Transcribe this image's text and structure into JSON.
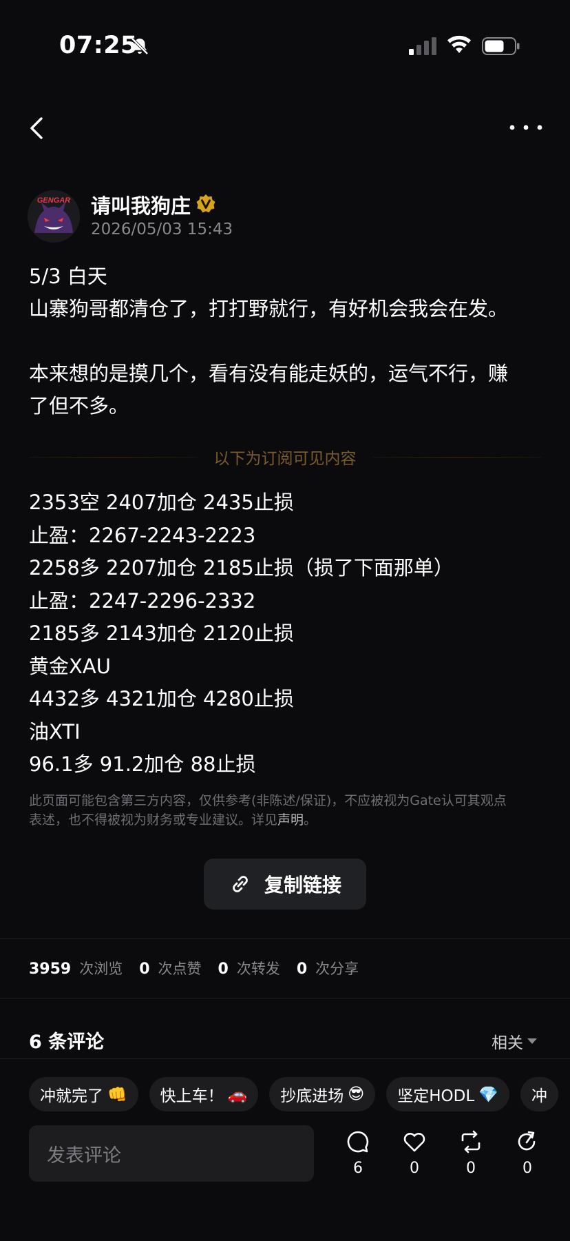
{
  "status": {
    "time": "07:25"
  },
  "author": {
    "name": "请叫我狗庄",
    "time": "2026/05/03 15:43",
    "avatar_text": "GENGAR"
  },
  "post": {
    "lines_a": [
      "5/3 白天",
      "山寨狗哥都清仓了，打打野就行，有好机会我会在发。"
    ],
    "lines_b": [
      "本来想的是摸几个，看有没有能走妖的，运气不行，赚",
      "了但不多。"
    ],
    "paywall_divider": "以下为订阅可见内容",
    "trades": [
      "2353空 2407加仓  2435止损",
      "止盈：2267-2243-2223",
      "2258多 2207加仓 2185止损（损了下面那单）",
      "止盈：2247-2296-2332",
      "2185多 2143加仓 2120止损",
      "黄金XAU",
      "4432多 4321加仓 4280止损",
      "油XTI",
      "96.1多  91.2加仓 88止损"
    ]
  },
  "disclaimer": {
    "line1": "此页面可能包含第三方内容，仅供参考(非陈述/保证)，不应被视为Gate认可其观点",
    "line2": "表述，也不得被视为财务或专业建议。详见",
    "link": "声明",
    "end": "。"
  },
  "copy_link_label": "复制链接",
  "stats": {
    "views": "3959",
    "views_label": "次浏览",
    "likes": "0",
    "likes_label": "次点赞",
    "reposts": "0",
    "reposts_label": "次转发",
    "shares": "0",
    "shares_label": "次分享"
  },
  "comments": {
    "title": "6 条评论",
    "sort": "相关"
  },
  "chips": [
    {
      "label": "冲就完了",
      "emoji": "👊"
    },
    {
      "label": "快上车！",
      "emoji": "🚗"
    },
    {
      "label": "抄底进场",
      "emoji": "😎"
    },
    {
      "label": "坚定HODL",
      "emoji": "💎"
    },
    {
      "label": "冲",
      "emoji": ""
    }
  ],
  "comment_placeholder": "发表评论",
  "actions": {
    "comments": "6",
    "likes": "0",
    "reposts": "0",
    "shares": "0"
  },
  "colors": {
    "accent_gold": "#d9a21b",
    "divider_text": "#7b5a2c"
  }
}
